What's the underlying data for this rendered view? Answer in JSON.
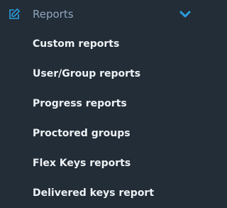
{
  "menu": {
    "title": "Reports",
    "header_icon": "edit-square-icon",
    "toggle_icon": "chevron-down-icon",
    "accent_color": "#2b9fe0",
    "title_color": "#8fa5bd",
    "background_color": "#232d37",
    "items": [
      {
        "label": "Custom reports"
      },
      {
        "label": "User/Group reports"
      },
      {
        "label": "Progress reports"
      },
      {
        "label": "Proctored groups"
      },
      {
        "label": "Flex Keys reports"
      },
      {
        "label": "Delivered keys report"
      }
    ]
  }
}
